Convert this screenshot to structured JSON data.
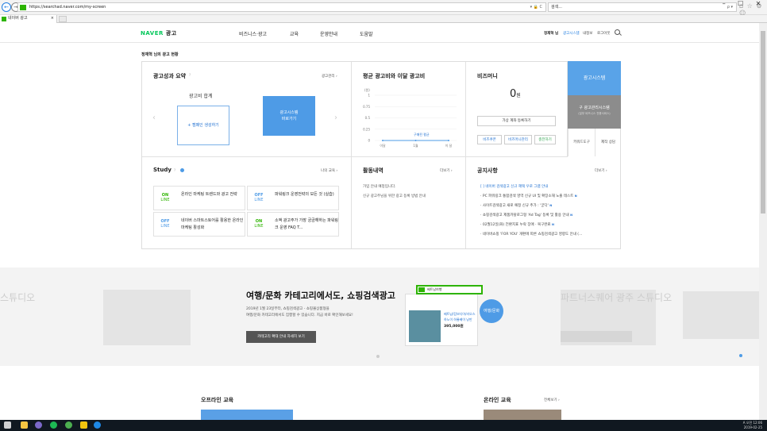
{
  "browser": {
    "url": "https://searchad.naver.com/my-screen",
    "url_ctl": "▾ 🔒 C",
    "search_value": "검색...",
    "search_ctl": "ρ ▾",
    "tab_title": "네이버 광고",
    "tab_close": "×",
    "window_controls": [
      "–",
      "☐",
      "✕"
    ],
    "nav_back": "←",
    "nav_fwd": "→",
    "toolbar_icons": "⌂ ☆ ⚙ ☺"
  },
  "header": {
    "logo": "NAVER",
    "logo_suffix": "광고",
    "menu": [
      "비즈니스·광고",
      "교육",
      "운영안내",
      "도움말"
    ],
    "user": "정재혁 님",
    "links": [
      "광고시스템",
      "내정보",
      "로그아웃"
    ]
  },
  "page_title": "정재혁 님의 광고 현황",
  "perf": {
    "title": "광고성과 요약",
    "info": "?",
    "more": "광고관리 ›",
    "subtitle": "광고비 합계",
    "campaign_btn": "+ 캠페인 생성하기",
    "system_btn_1": "광고시스템",
    "system_btn_2": "바로가기"
  },
  "avg": {
    "title": "평균 광고비와 이달 광고비",
    "y_unit": "(원)",
    "y_ticks": [
      "1",
      "0.75",
      "0.5",
      "0.25",
      "0"
    ],
    "x_ticks": [
      "이달",
      "1월",
      "이 달"
    ],
    "tooltip": "구매된 평균",
    "zero": "0"
  },
  "chart_data": {
    "type": "line",
    "title": "평균 광고비와 이달 광고비",
    "ylabel": "(원)",
    "ylim": [
      0,
      1
    ],
    "categories": [
      "이달",
      "1월",
      "이 달"
    ],
    "series": [
      {
        "values": [
          0,
          0,
          0
        ]
      }
    ]
  },
  "bizmoney": {
    "title": "비즈머니",
    "amount": "0",
    "unit": "원",
    "virtual_btn": "가상 계좌 등록하기",
    "btns": [
      "비즈쿠폰",
      "비즈머니관리",
      "충전하기"
    ]
  },
  "side": {
    "system": "광고시스템",
    "old_system": "구 광고관리시스템",
    "old_sub": "(일부 비즈니스 전용서비스)",
    "tools": "키워드도구",
    "consult": "제작 상담"
  },
  "study": {
    "title": "Study",
    "info": "?",
    "more": "나의 교육 ›",
    "items": [
      {
        "on": "ON",
        "line": "LINE",
        "text": "온라인 마케팅 트렌드와 광고 전략"
      },
      {
        "on": "OFF",
        "line": "LINE",
        "text": "파워링크 운영전략의 모든 것 (실습)"
      },
      {
        "on": "OFF",
        "line": "LINE",
        "text": "네이버 스마트스토어를 활용한 온라인 마케팅 활성화"
      },
      {
        "on": "ON",
        "line": "LINE",
        "text": "소액 광고주가 가장 궁금해하는 파워링크 운영 FAQ T..."
      }
    ]
  },
  "activity": {
    "title": "활동내역",
    "more": "더보기 ›",
    "items": [
      "가입 안내 예정입니다.",
      "신규 광고주님을 위한 광고 등록 방법 안내"
    ]
  },
  "notice": {
    "title": "공지사항",
    "more": "더보기 ›",
    "new": "N",
    "items": [
      "[ ] 네이버 검색광고 신규 혜택 우로 그램 안내",
      "· PC 파워링크 통합검색 영역 신규 UI 및 확장소재 노출 테스트",
      "· 사이트검색광고 새로 예정 신규 추가 : '궁닥'",
      "· 쇼핑검색광고 제품카탈로그형 'Ad Tag' 등록 및 활용 안내",
      "· 02월12일(화) 전환지표 누락 장애 · 복구완료",
      "· 네이버쇼핑 'FOR YOU' 개편에 따른 쇼핑검색광고 영향도 안내 (..."
    ]
  },
  "banner": {
    "title": "여행/문화 카테고리에서도, 쇼핑검색광고",
    "sub1": "2019년 1월 23일부터, 쇼핑검색광고 - 쇼핑몰상품형을",
    "sub2": "여행/문화 카테고리에서도 집행할 수 있습니다. 지금 바로 확인해보세요!",
    "btn": "카테고리 확대 안내 자세히 보기",
    "left_fade": "스튜디오",
    "right_fade": "파트너스퀘어 광주 스튜디오",
    "circle": "여행/문화",
    "phone_search": "베트남여행",
    "phone_items": [
      "베트남/캄보디아/라오스",
      "하노이 하롱베이 낭만",
      "395,000원"
    ]
  },
  "offline_title": "오프라인 교육",
  "online_title": "온라인 교육",
  "online_more": "전체보기 ›",
  "tray": {
    "ime": "A",
    "time": "오전 12:06",
    "date": "2019-02-25"
  }
}
